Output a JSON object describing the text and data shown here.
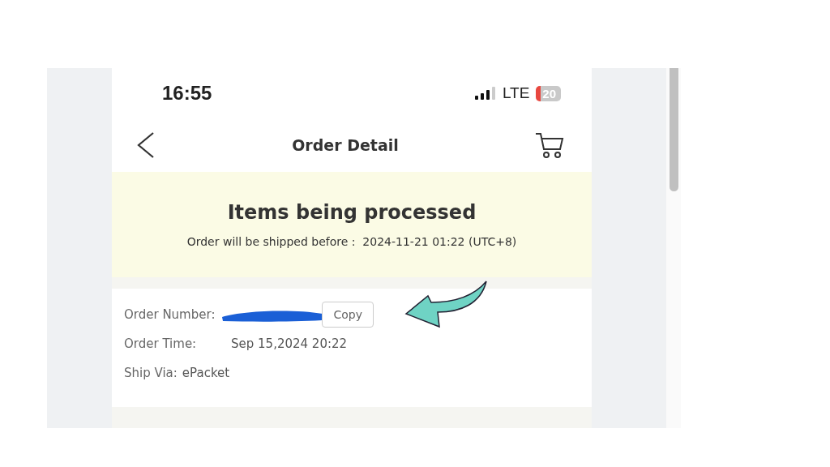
{
  "status_bar": {
    "time": "16:55",
    "network": "LTE",
    "battery": "20"
  },
  "nav": {
    "title": "Order Detail"
  },
  "banner": {
    "title": "Items being processed",
    "subtitle": "Order will be shipped before :  2024-11-21 01:22 (UTC+8)"
  },
  "order_info": {
    "rows": [
      {
        "kind": "redacted",
        "label": "Order Number:",
        "button": "Copy"
      },
      {
        "kind": "column",
        "label": "Order Time:",
        "value": "Sep 15,2024 20:22"
      },
      {
        "kind": "inline",
        "label": "Ship Via:",
        "value": "ePacket"
      }
    ]
  }
}
